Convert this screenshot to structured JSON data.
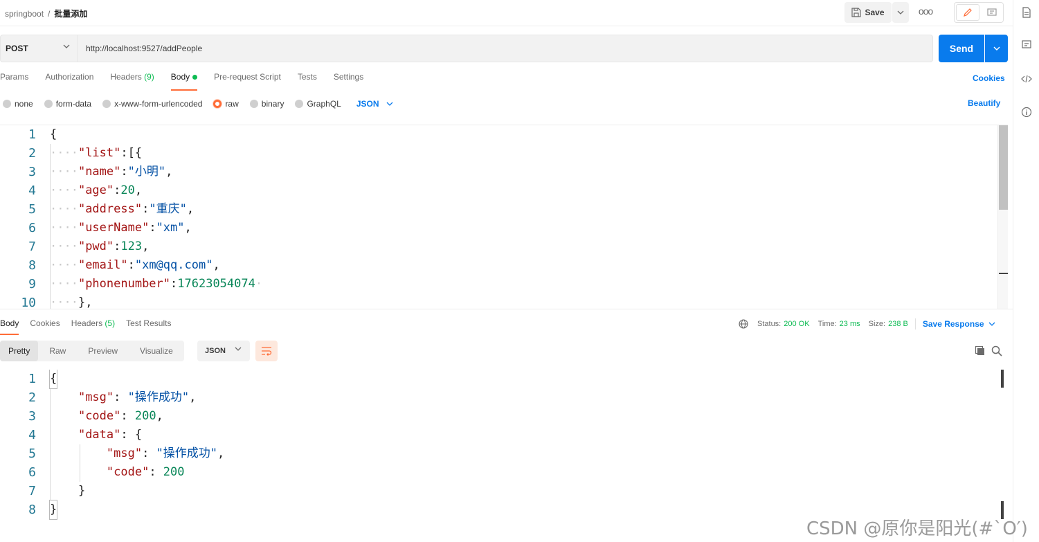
{
  "breadcrumb": {
    "collection": "springboot",
    "separator": "/",
    "request": "批量添加"
  },
  "toolbar": {
    "save_label": "Save",
    "more_label": "ooo"
  },
  "request": {
    "method": "POST",
    "url": "http://localhost:9527/addPeople",
    "send_label": "Send"
  },
  "req_tabs": {
    "params": "Params",
    "authorization": "Authorization",
    "headers": "Headers",
    "headers_count": "(9)",
    "body": "Body",
    "prerequest": "Pre-request Script",
    "tests": "Tests",
    "settings": "Settings",
    "cookies": "Cookies"
  },
  "body_types": {
    "none": "none",
    "form_data": "form-data",
    "urlencoded": "x-www-form-urlencoded",
    "raw": "raw",
    "binary": "binary",
    "graphql": "GraphQL",
    "format": "JSON",
    "beautify": "Beautify"
  },
  "request_body": {
    "line_numbers": [
      "1",
      "2",
      "3",
      "4",
      "5",
      "6",
      "7",
      "8",
      "9",
      "10"
    ],
    "l1": "{",
    "l2_key": "\"list\"",
    "l2_rest": ":[{",
    "l3_key": "\"name\"",
    "l3_val": "\"小明\"",
    "l4_key": "\"age\"",
    "l4_val": "20",
    "l5_key": "\"address\"",
    "l5_val": "\"重庆\"",
    "l6_key": "\"userName\"",
    "l6_val": "\"xm\"",
    "l7_key": "\"pwd\"",
    "l7_val": "123",
    "l8_key": "\"email\"",
    "l8_val": "\"xm@qq.com\"",
    "l9_key": "\"phonenumber\"",
    "l9_val": "17623054074",
    "l10": "},"
  },
  "response_tabs": {
    "body": "Body",
    "cookies": "Cookies",
    "headers": "Headers",
    "headers_count": "(5)",
    "test_results": "Test Results"
  },
  "response_status": {
    "status_label": "Status:",
    "status_value": "200 OK",
    "time_label": "Time:",
    "time_value": "23 ms",
    "size_label": "Size:",
    "size_value": "238 B",
    "save_response": "Save Response"
  },
  "response_views": {
    "pretty": "Pretty",
    "raw": "Raw",
    "preview": "Preview",
    "visualize": "Visualize",
    "format": "JSON"
  },
  "response_body": {
    "line_numbers": [
      "1",
      "2",
      "3",
      "4",
      "5",
      "6",
      "7",
      "8"
    ],
    "l1": "{",
    "l2_key": "\"msg\"",
    "l2_val": "\"操作成功\"",
    "l3_key": "\"code\"",
    "l3_val": "200",
    "l4_key": "\"data\"",
    "l4_rest": "{",
    "l5_key": "\"msg\"",
    "l5_val": "\"操作成功\"",
    "l6_key": "\"code\"",
    "l6_val": "200",
    "l7": "}",
    "l8": "}"
  },
  "watermark": "CSDN @原你是阳光(#`O′)",
  "colors": {
    "accent": "#ff6c37",
    "primary": "#097bed",
    "success": "#0cbb52"
  }
}
